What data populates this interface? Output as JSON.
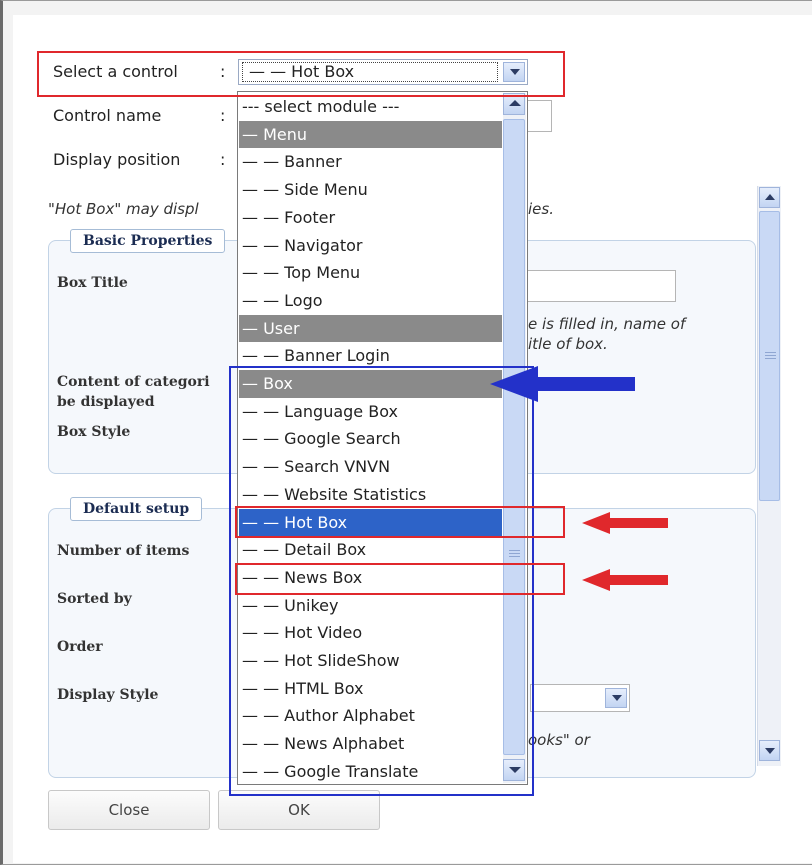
{
  "form": {
    "select_control_label": "Select a control",
    "control_name_label": "Control name",
    "display_position_label": "Display position",
    "colon": ":",
    "selected_value": "— — Hot Box",
    "note_left": "\"Hot Box\" may displ",
    "note_right": "ies."
  },
  "basic_properties": {
    "legend": "Basic Properties",
    "box_title_label": "Box Title",
    "content_label_line1": "Content of categori",
    "content_label_line2": "be displayed",
    "box_style_label": "Box Style",
    "hint_line1": "e is filled in, name of",
    "hint_line2": "itle of box."
  },
  "default_setup": {
    "legend": "Default setup",
    "number_of_items_label": "Number of items",
    "sorted_by_label": "Sorted by",
    "order_label": "Order",
    "display_style_label": "Display Style",
    "hint_partial": "ooks\" or"
  },
  "dropdown": {
    "options": [
      {
        "label": "--- select module ---",
        "type": "option"
      },
      {
        "label": "— Menu",
        "type": "group"
      },
      {
        "label": "— — Banner",
        "type": "option"
      },
      {
        "label": "— — Side Menu",
        "type": "option"
      },
      {
        "label": "— — Footer",
        "type": "option"
      },
      {
        "label": "— — Navigator",
        "type": "option"
      },
      {
        "label": "— — Top Menu",
        "type": "option"
      },
      {
        "label": "— — Logo",
        "type": "option"
      },
      {
        "label": "— User",
        "type": "group"
      },
      {
        "label": "— — Banner Login",
        "type": "option"
      },
      {
        "label": "— Box",
        "type": "group"
      },
      {
        "label": "— — Language Box",
        "type": "option"
      },
      {
        "label": "— — Google Search",
        "type": "option"
      },
      {
        "label": "— — Search VNVN",
        "type": "option"
      },
      {
        "label": "— — Website Statistics",
        "type": "option"
      },
      {
        "label": "— — Hot Box",
        "type": "selected"
      },
      {
        "label": "— — Detail Box",
        "type": "option"
      },
      {
        "label": "— — News Box",
        "type": "option"
      },
      {
        "label": "— — Unikey",
        "type": "option"
      },
      {
        "label": "— — Hot Video",
        "type": "option"
      },
      {
        "label": "— — Hot SlideShow",
        "type": "option"
      },
      {
        "label": "— — HTML Box",
        "type": "option"
      },
      {
        "label": "— — Author Alphabet",
        "type": "option"
      },
      {
        "label": "— — News Alphabet",
        "type": "option"
      },
      {
        "label": "— — Google Translate",
        "type": "option"
      }
    ]
  },
  "buttons": {
    "close": "Close",
    "ok": "OK"
  },
  "colors": {
    "annotation_red": "#e0282c",
    "annotation_blue": "#2331c9",
    "selection_blue": "#2d63c8",
    "group_gray": "#8a8a8a"
  }
}
